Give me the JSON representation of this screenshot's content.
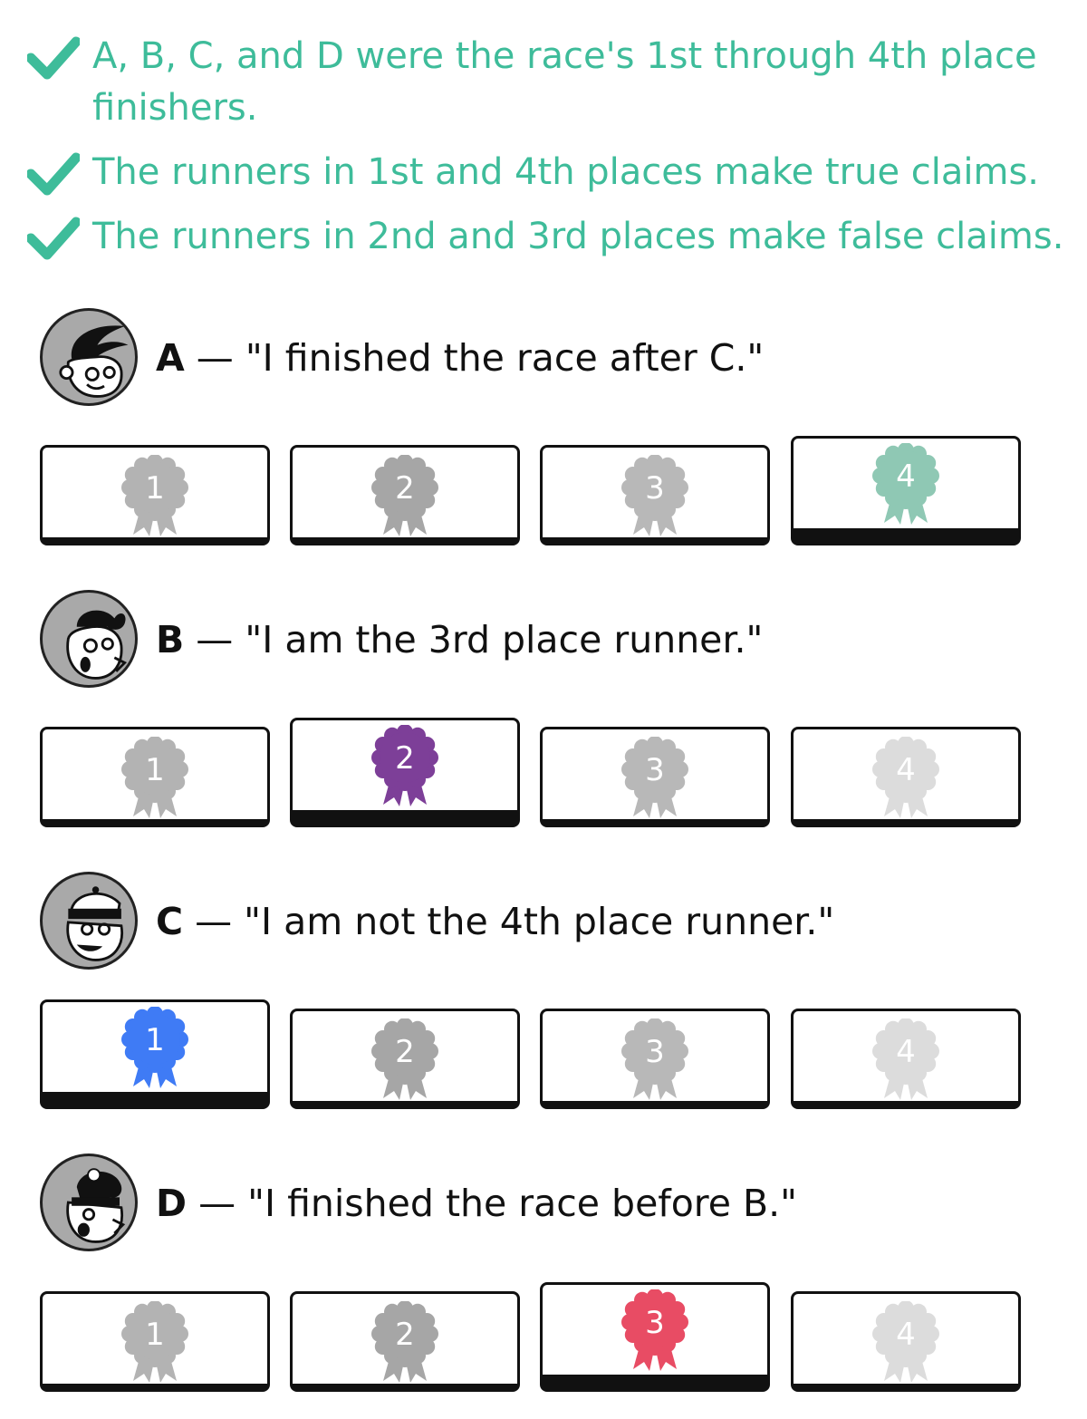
{
  "conditions": [
    {
      "text": "A, B, C, and D were the race's 1st through 4th place finishers."
    },
    {
      "text": "The runners in 1st and 4th places make true claims."
    },
    {
      "text": "The runners in 2nd and 3rd places make false claims."
    }
  ],
  "runners": [
    {
      "letter": "A",
      "dash": " — ",
      "quote": "\"I finished the race after C.\"",
      "avatar": "runner-a-avatar",
      "selected_place": 4
    },
    {
      "letter": "B",
      "dash": " — ",
      "quote": "\"I am the 3rd place runner.\"",
      "avatar": "runner-b-avatar",
      "selected_place": 2
    },
    {
      "letter": "C",
      "dash": " — ",
      "quote": "\"I am not the 4th place runner.\"",
      "avatar": "runner-c-avatar",
      "selected_place": 1
    },
    {
      "letter": "D",
      "dash": " — ",
      "quote": "\"I finished the race before B.\"",
      "avatar": "runner-d-avatar",
      "selected_place": 3
    }
  ],
  "places": [
    {
      "label": "1",
      "color": "#3f7bf5"
    },
    {
      "label": "2",
      "color": "#7d3f98"
    },
    {
      "label": "3",
      "color": "#e84c64"
    },
    {
      "label": "4",
      "color": "#8fc8b4"
    }
  ],
  "unselected_colors": [
    "#b3b3b3",
    "#a6a6a6",
    "#b8b8b8",
    "#dcdcdc"
  ],
  "check_color": "#3ebc9a"
}
